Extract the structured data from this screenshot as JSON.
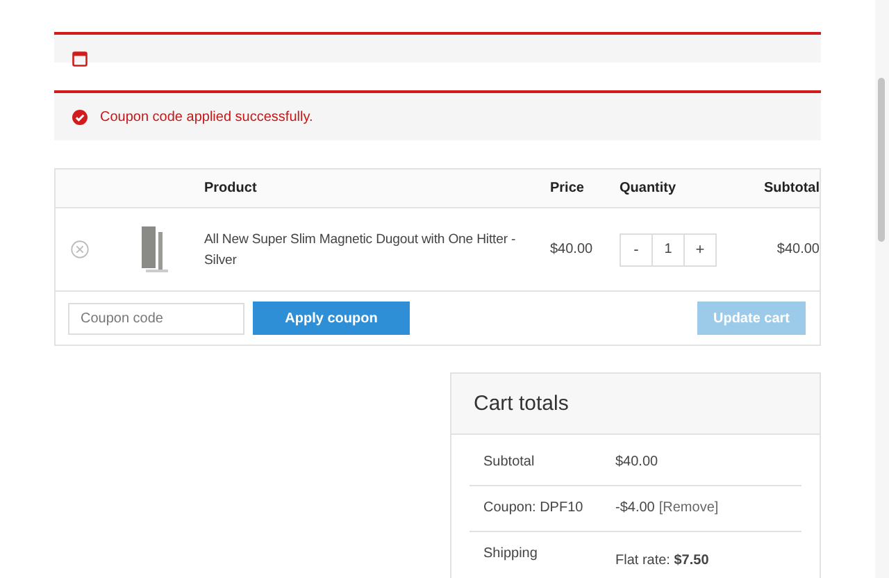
{
  "notices": [
    {
      "kind": "empty"
    },
    {
      "kind": "success",
      "text": "Coupon code applied successfully."
    }
  ],
  "cart_table": {
    "columns": [
      "Product",
      "Price",
      "Quantity",
      "Subtotal"
    ],
    "rows": [
      {
        "product": "All New Super Slim Magnetic Dugout with One Hitter - Silver",
        "price": "$40.00",
        "minus": "-",
        "quantity": "1",
        "plus": "+",
        "subtotal": "$40.00"
      }
    ],
    "coupon": {
      "placeholder": "Coupon code"
    },
    "apply_button": "Apply coupon",
    "update_button": {
      "label": "Update cart",
      "disabled": true
    }
  },
  "cart_totals": {
    "title": "Cart totals",
    "rows": [
      {
        "kind": "plain",
        "label": "Subtotal",
        "value": "$40.00"
      },
      {
        "kind": "coupon",
        "label": "Coupon: DPF10",
        "value": "-$4.00",
        "link": "[Remove]"
      },
      {
        "kind": "shipping",
        "label": "Shipping",
        "value": "Flat rate: **$7.50**"
      }
    ]
  }
}
